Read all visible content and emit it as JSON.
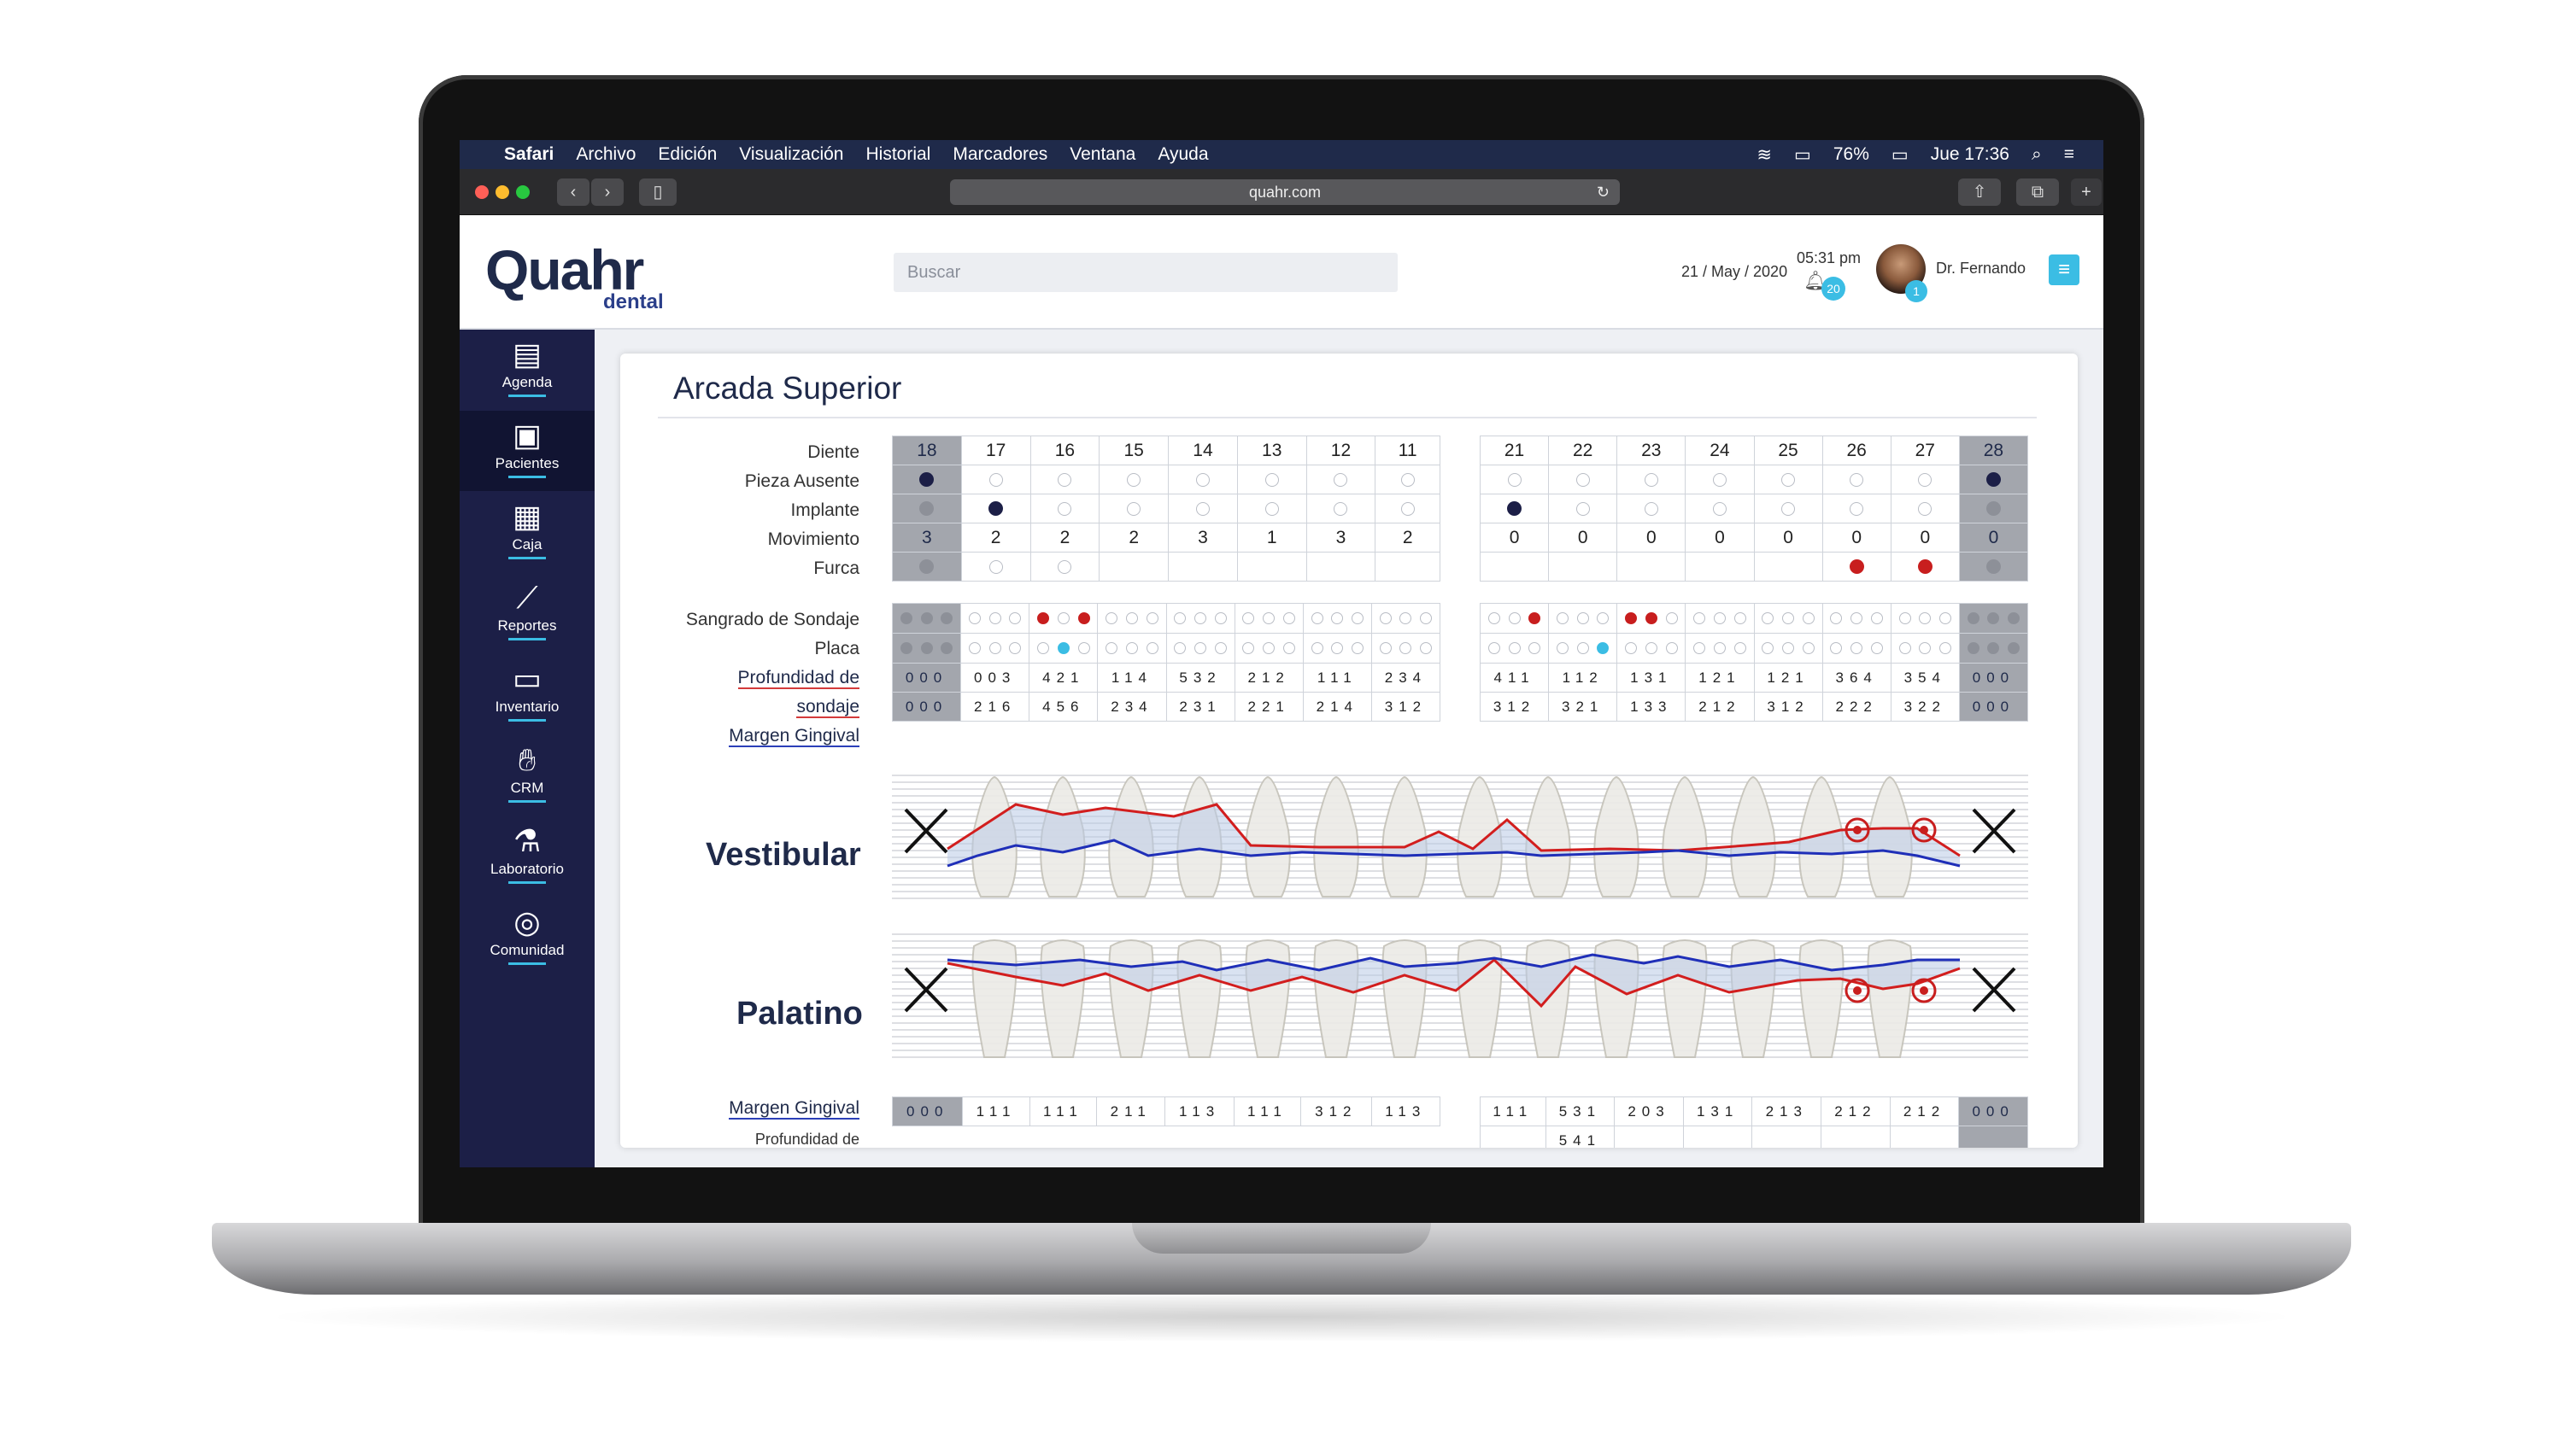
{
  "menubar": {
    "app": "Safari",
    "items": [
      "Archivo",
      "Edición",
      "Visualización",
      "Historial",
      "Marcadores",
      "Ventana",
      "Ayuda"
    ],
    "battery": "76%",
    "clock": "Jue 17:36"
  },
  "browser": {
    "url": "quahr.com"
  },
  "header": {
    "logo_main": "Quahr",
    "logo_sub": "dental",
    "search_placeholder": "Buscar",
    "date": "21 / May / 2020",
    "time": "05:31 pm",
    "notifications": "20",
    "messages": "1",
    "user": "Dr. Fernando"
  },
  "sidebar": [
    {
      "label": "Agenda",
      "icon": "notebook-icon"
    },
    {
      "label": "Pacientes",
      "icon": "id-card-icon"
    },
    {
      "label": "Caja",
      "icon": "cash-register-icon"
    },
    {
      "label": "Reportes",
      "icon": "chart-icon"
    },
    {
      "label": "Inventario",
      "icon": "archive-icon"
    },
    {
      "label": "CRM",
      "icon": "handshake-icon"
    },
    {
      "label": "Laboratorio",
      "icon": "microscope-icon"
    },
    {
      "label": "Comunidad",
      "icon": "community-icon"
    }
  ],
  "card": {
    "title": "Arcada Superior"
  },
  "rows": {
    "diente": "Diente",
    "ausente": "Pieza Ausente",
    "implante": "Implante",
    "movimiento": "Movimiento",
    "furca": "Furca",
    "sangrado": "Sangrado de Sondaje",
    "placa": "Placa",
    "profundidad1": "Profundidad de",
    "profundidad2": "sondaje",
    "margen": "Margen Gingival",
    "margen2": "Margen Gingival",
    "profundidad_cut": "Profundidad de"
  },
  "views": {
    "vestibular": "Vestibular",
    "palatino": "Palatino"
  },
  "left_teeth": [
    "18",
    "17",
    "16",
    "15",
    "14",
    "13",
    "12",
    "11"
  ],
  "right_teeth": [
    "21",
    "22",
    "23",
    "24",
    "25",
    "26",
    "27",
    "28"
  ],
  "movimiento_left": [
    "3",
    "2",
    "2",
    "2",
    "3",
    "1",
    "3",
    "2"
  ],
  "movimiento_right": [
    "0",
    "0",
    "0",
    "0",
    "0",
    "0",
    "0",
    "0"
  ],
  "ausente_left": [
    "filled",
    "empty",
    "empty",
    "empty",
    "empty",
    "empty",
    "empty",
    "empty"
  ],
  "ausente_right": [
    "empty",
    "empty",
    "empty",
    "empty",
    "empty",
    "empty",
    "empty",
    "filled"
  ],
  "implante_left": [
    "gray",
    "filled",
    "empty",
    "empty",
    "empty",
    "empty",
    "empty",
    "empty"
  ],
  "implante_right": [
    "filled",
    "empty",
    "empty",
    "empty",
    "empty",
    "empty",
    "empty",
    "gray"
  ],
  "furca_left": [
    "gray",
    "empty",
    "empty",
    "",
    "",
    "",
    "",
    ""
  ],
  "furca_right": [
    "",
    "",
    "",
    "",
    "",
    "red",
    "red",
    "gray"
  ],
  "sangrado_left": [
    "ggg",
    "ooo",
    "ror",
    "ooo",
    "ooo",
    "ooo",
    "ooo",
    "ooo"
  ],
  "sangrado_right": [
    "oor",
    "ooo",
    "rro",
    "ooo",
    "ooo",
    "ooo",
    "ooo",
    "ggg"
  ],
  "placa_left": [
    "ggg",
    "ooo",
    "obo",
    "ooo",
    "ooo",
    "ooo",
    "ooo",
    "ooo"
  ],
  "placa_right": [
    "ooo",
    "oob",
    "ooo",
    "ooo",
    "ooo",
    "ooo",
    "ooo",
    "ggg"
  ],
  "prof1_left": [
    "000",
    "003",
    "421",
    "114",
    "532",
    "212",
    "111",
    "234"
  ],
  "prof1_right": [
    "411",
    "112",
    "131",
    "121",
    "121",
    "364",
    "354",
    "000"
  ],
  "prof2_left": [
    "000",
    "216",
    "456",
    "234",
    "231",
    "221",
    "214",
    "312"
  ],
  "prof2_right": [
    "312",
    "321",
    "133",
    "212",
    "312",
    "222",
    "322",
    "000"
  ],
  "mg_left": [
    "000",
    "111",
    "111",
    "211",
    "113",
    "111",
    "312",
    "113"
  ],
  "mg_right": [
    "111",
    "531",
    "203",
    "131",
    "213",
    "212",
    "212",
    "000"
  ],
  "prof_cut_right": [
    "",
    "541",
    "",
    "",
    "",
    "",
    "",
    ""
  ],
  "colors": {
    "navy": "#1c1f47",
    "accent": "#3bbde4",
    "red": "#c81e1e",
    "blue": "#1f2fb8"
  }
}
